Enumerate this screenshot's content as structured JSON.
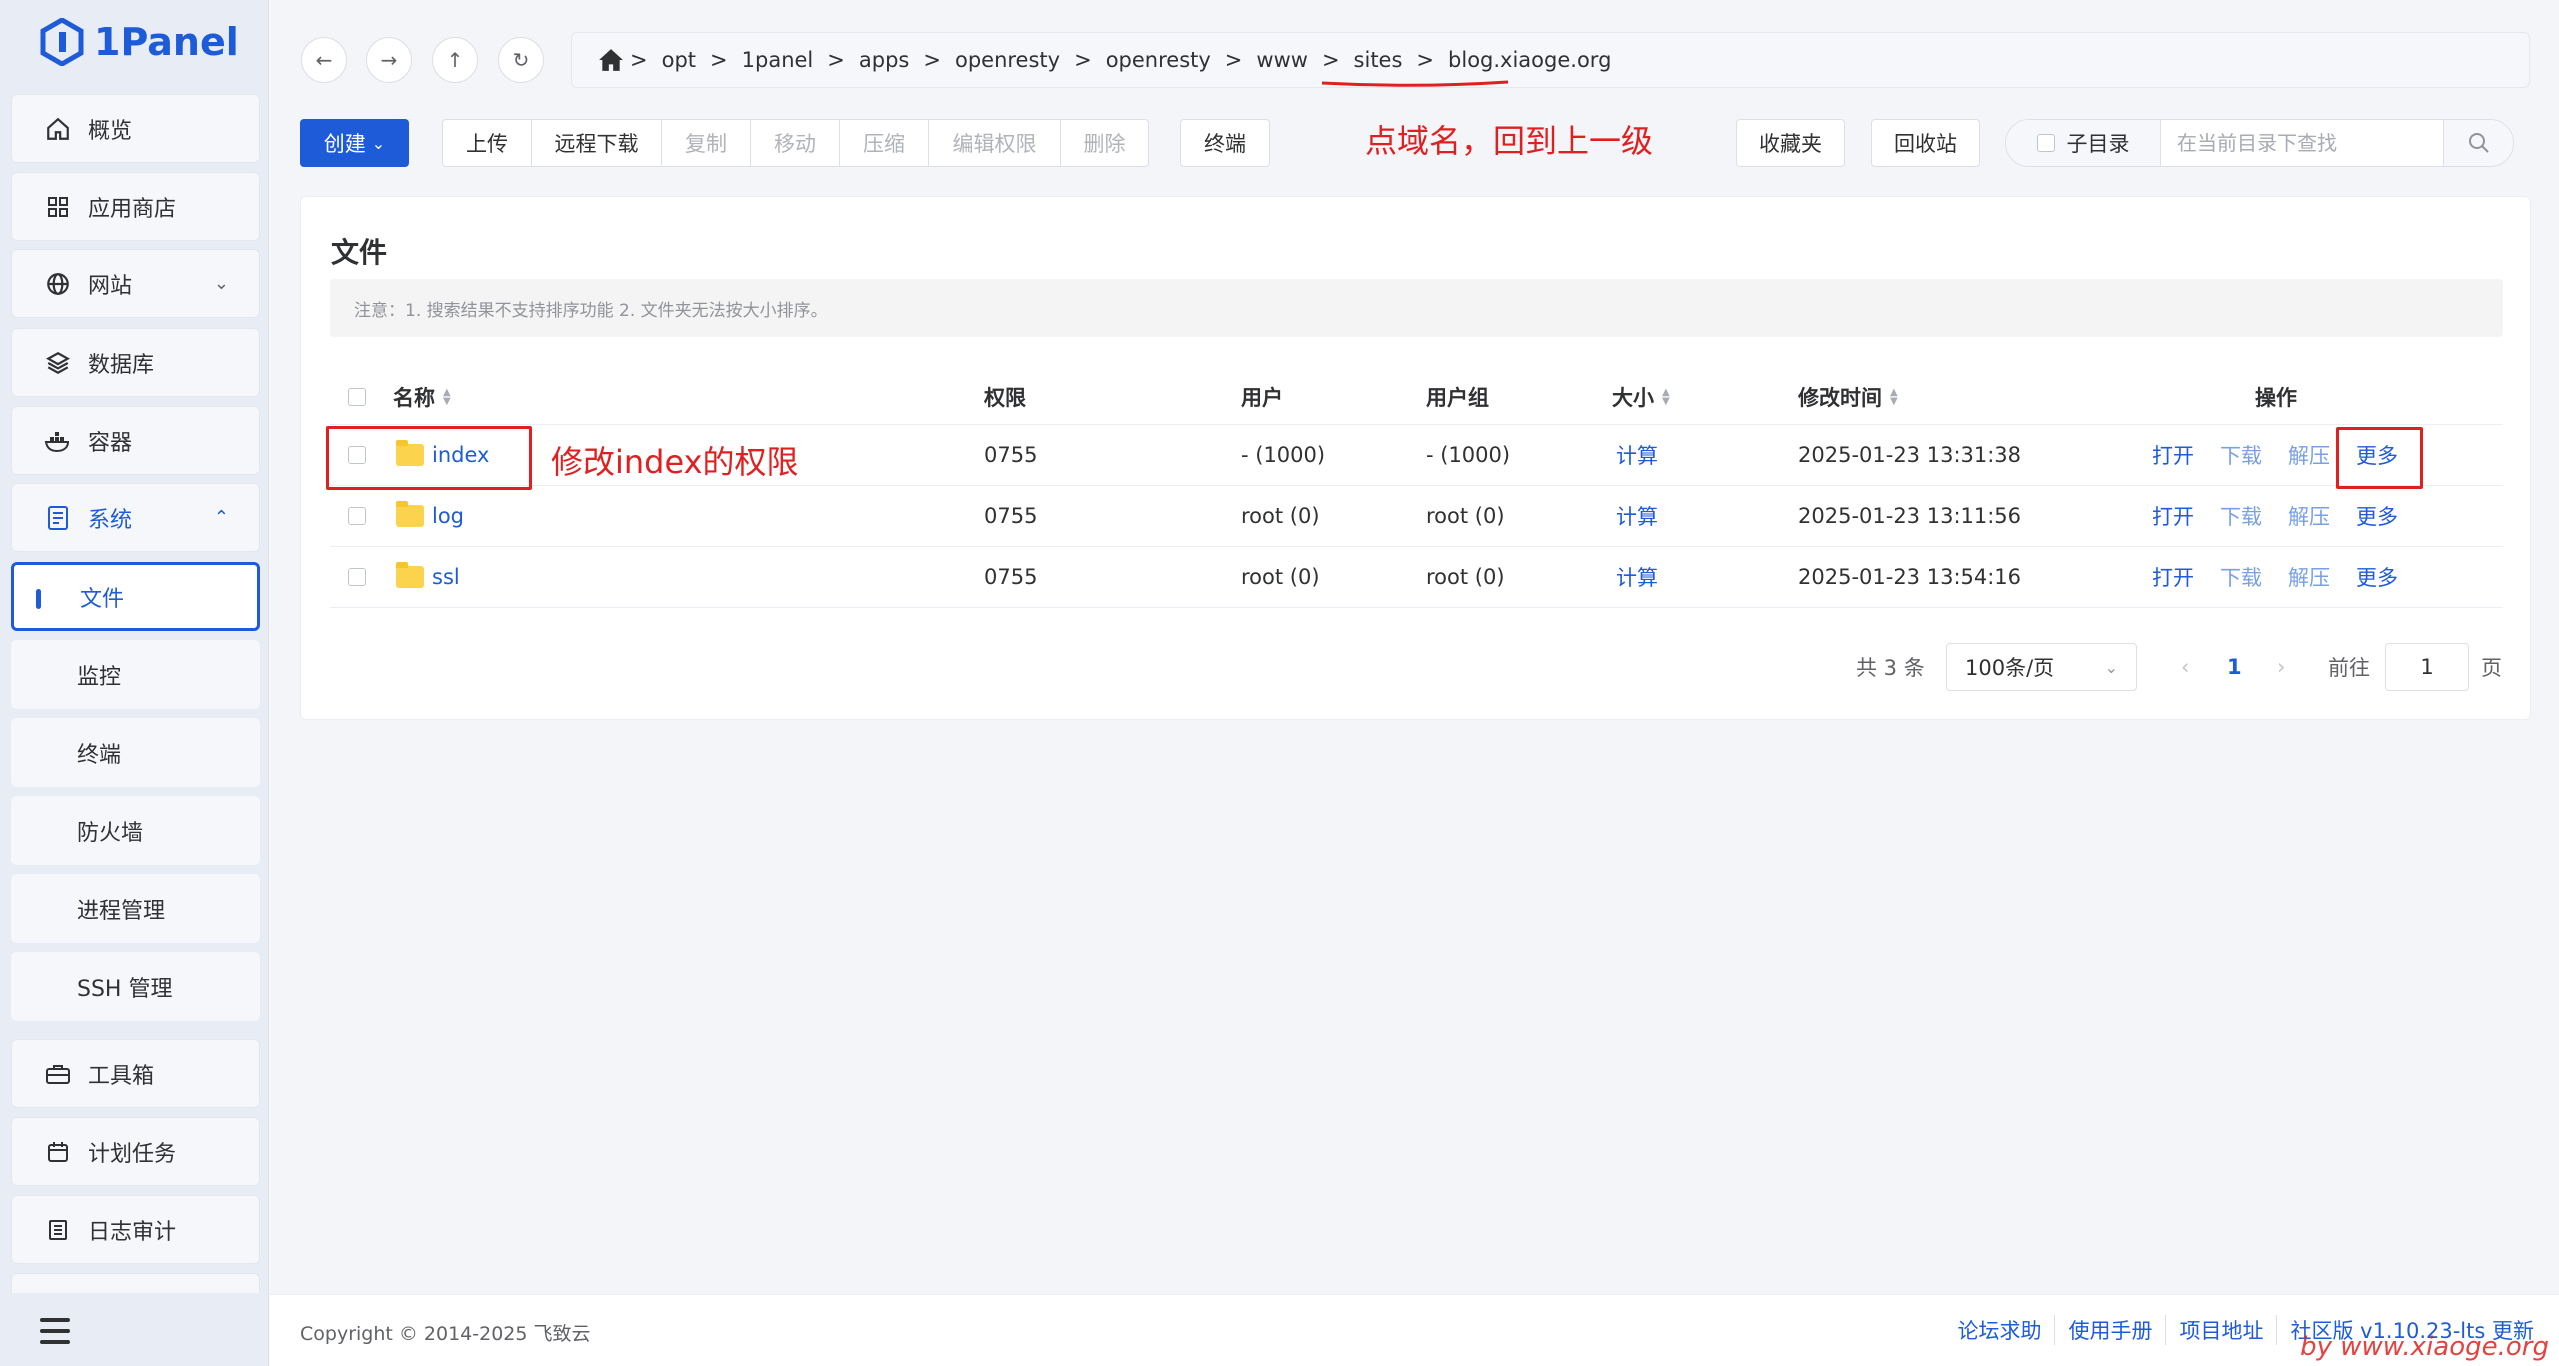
{
  "brand": {
    "name": "1Panel"
  },
  "sidebar": {
    "items": [
      {
        "label": "概览",
        "icon": "home-icon"
      },
      {
        "label": "应用商店",
        "icon": "grid-icon"
      },
      {
        "label": "网站",
        "icon": "globe-icon"
      },
      {
        "label": "数据库",
        "icon": "layers-icon"
      },
      {
        "label": "容器",
        "icon": "docker-icon"
      },
      {
        "label": "系统",
        "icon": "doc-icon"
      },
      {
        "label": "工具箱",
        "icon": "toolbox-icon"
      },
      {
        "label": "计划任务",
        "icon": "calendar-icon"
      },
      {
        "label": "日志审计",
        "icon": "log-icon"
      }
    ],
    "system_children": [
      "文件",
      "监控",
      "终端",
      "防火墙",
      "进程管理",
      "SSH 管理"
    ]
  },
  "breadcrumb": [
    "opt",
    "1panel",
    "apps",
    "openresty",
    "openresty",
    "www",
    "sites",
    "blog.xiaoge.org"
  ],
  "toolbar": {
    "create": "创建",
    "upload": "上传",
    "remote_download": "远程下载",
    "copy": "复制",
    "move": "移动",
    "compress": "压缩",
    "edit_perm": "编辑权限",
    "delete": "删除",
    "terminal": "终端",
    "favorites": "收藏夹",
    "recycle": "回收站",
    "subdir": "子目录",
    "search_placeholder": "在当前目录下查找"
  },
  "annotations": {
    "breadcrumb_note": "点域名，回到上一级",
    "row_note": "修改index的权限"
  },
  "files": {
    "title": "文件",
    "notice": "注意：1. 搜索结果不支持排序功能 2. 文件夹无法按大小排序。",
    "columns": [
      "名称",
      "权限",
      "用户",
      "用户组",
      "大小",
      "修改时间",
      "操作"
    ],
    "rows": [
      {
        "name": "index",
        "perm": "0755",
        "user": "- (1000)",
        "group": "- (1000)",
        "size": "计算",
        "mtime": "2025-01-23 13:31:38"
      },
      {
        "name": "log",
        "perm": "0755",
        "user": "root (0)",
        "group": "root (0)",
        "size": "计算",
        "mtime": "2025-01-23 13:11:56"
      },
      {
        "name": "ssl",
        "perm": "0755",
        "user": "root (0)",
        "group": "root (0)",
        "size": "计算",
        "mtime": "2025-01-23 13:54:16"
      }
    ],
    "actions": {
      "open": "打开",
      "download": "下载",
      "extract": "解压",
      "more": "更多"
    }
  },
  "pagination": {
    "total": "共 3 条",
    "page_size": "100条/页",
    "current": "1",
    "goto_label": "前往",
    "goto_value": "1",
    "page_suffix": "页"
  },
  "footer": {
    "copyright": "Copyright © 2014-2025 飞致云",
    "links": [
      "论坛求助",
      "使用手册",
      "项目地址",
      "社区版 v1.10.23-lts 更新"
    ]
  },
  "watermark": "by www.xiaoge.org",
  "colors": {
    "primary": "#1d5bd8",
    "annotation": "#e02020"
  }
}
